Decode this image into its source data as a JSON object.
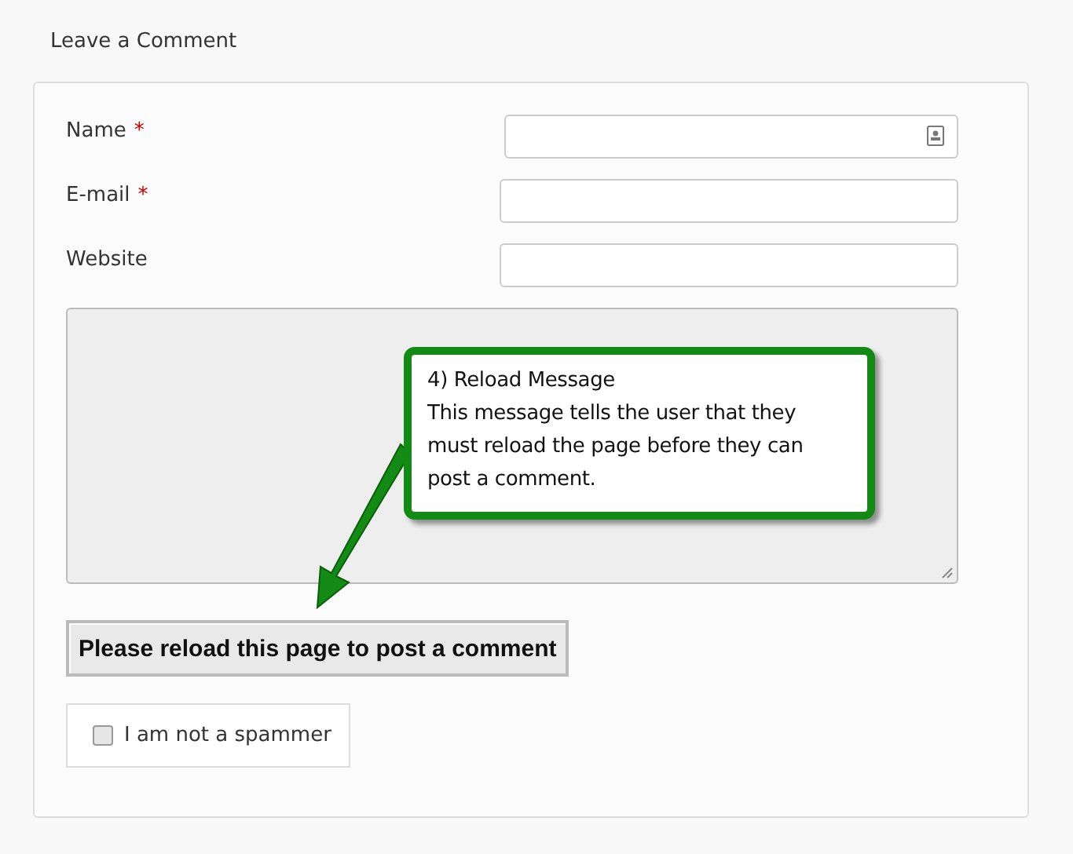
{
  "heading": "Leave a Comment",
  "fields": [
    {
      "label": "Name",
      "required_mark": "*",
      "kind": "contact"
    },
    {
      "label": "E-mail",
      "required_mark": "*",
      "kind": "text"
    },
    {
      "label": "Website",
      "kind": "text"
    }
  ],
  "comment": {
    "disabled": true
  },
  "reload_button": "Please reload this page to post a comment",
  "spam_check": {
    "label": "I am not a spammer",
    "checked": false
  },
  "callout": {
    "title": "4) Reload Message",
    "body": "This message tells the user that they must reload the page before they can post a comment."
  }
}
